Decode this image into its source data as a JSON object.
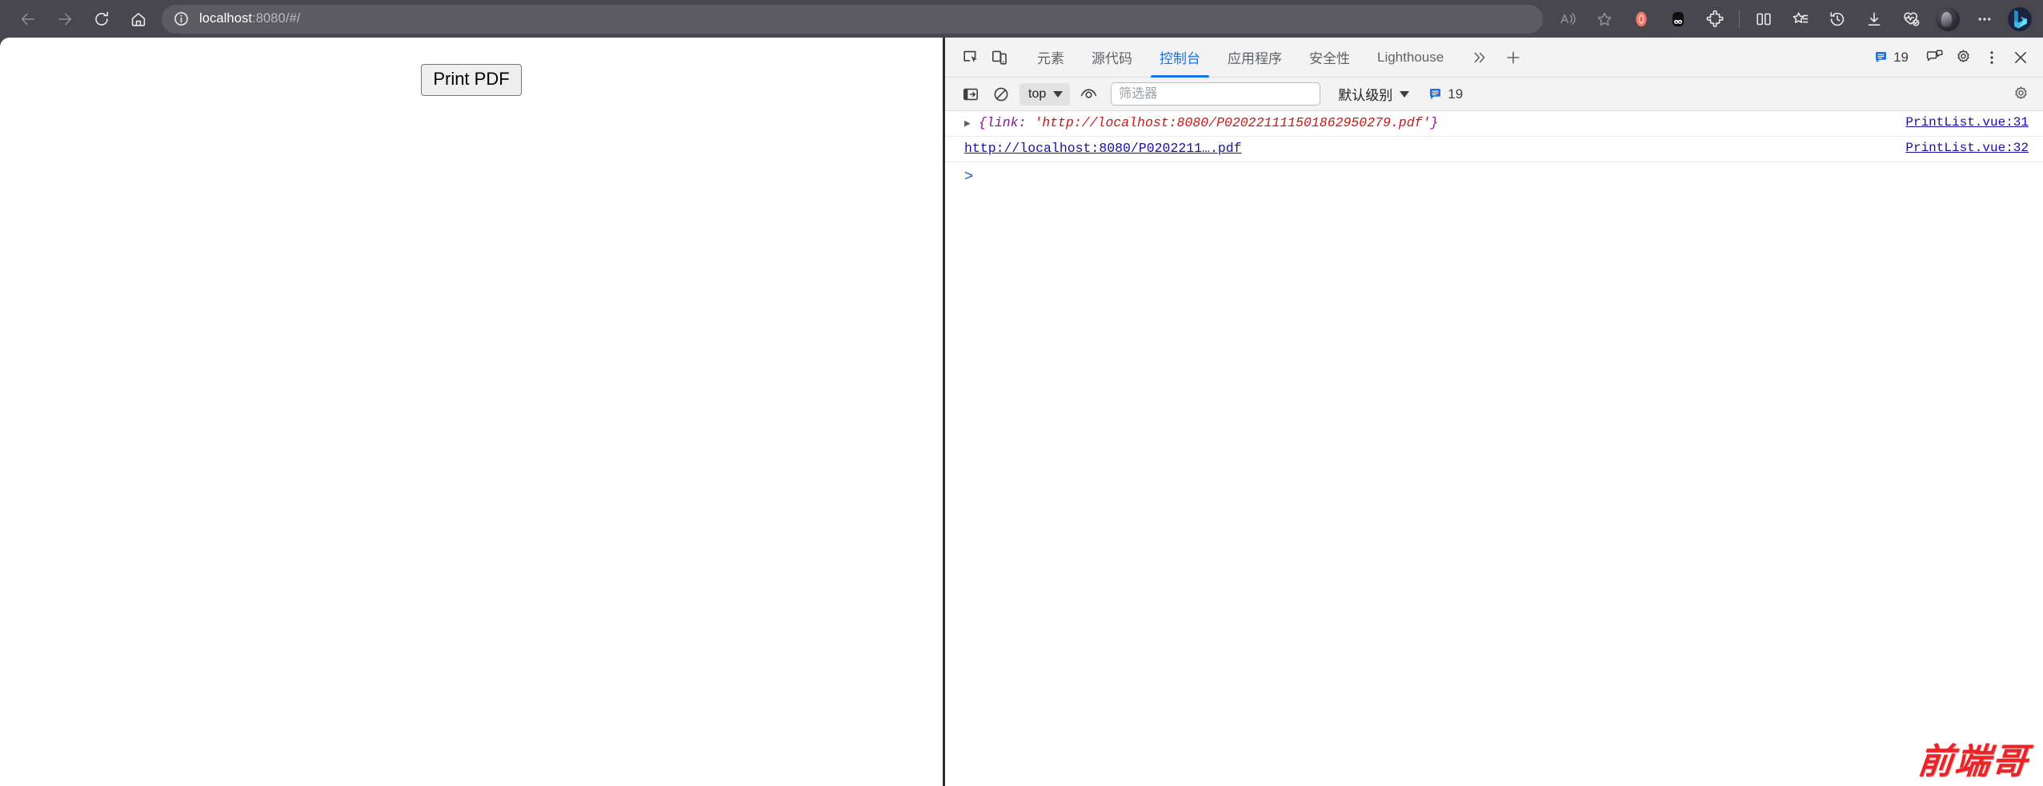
{
  "browser": {
    "nav": {
      "back": "Back",
      "forward": "Forward",
      "refresh": "Refresh",
      "home": "Home"
    },
    "address": {
      "host": "localhost",
      "rest": ":8080/#/",
      "full_url": "localhost:8080/#/",
      "site_info_label": "View site information"
    },
    "toolbar_icons": [
      "read-aloud-icon",
      "favorite-star-icon",
      "opera-circle-icon",
      "panda-extension-icon",
      "extensions-puzzle-icon",
      "split-screen-icon",
      "collections-icon",
      "history-icon",
      "downloads-icon",
      "browser-essentials-icon",
      "profile-avatar",
      "settings-more-icon",
      "copilot-bing-icon"
    ],
    "chrome_bg": "#47474d",
    "address_bg": "#5b5b61"
  },
  "page": {
    "print_button_label": "Print PDF",
    "watermark": "前端哥",
    "watermark_color": "#e8262a"
  },
  "devtools": {
    "accent_color": "#1a73e8",
    "inspect_icon": "inspect-element-icon",
    "device_icon": "device-toolbar-icon",
    "tabs": [
      {
        "label": "元素",
        "active": false
      },
      {
        "label": "源代码",
        "active": false
      },
      {
        "label": "控制台",
        "active": true
      },
      {
        "label": "应用程序",
        "active": false
      },
      {
        "label": "安全性",
        "active": false
      },
      {
        "label": "Lighthouse",
        "active": false
      }
    ],
    "more_tabs_label": "»",
    "add_tab_label": "+",
    "message_count": "19",
    "tabbar_icons": [
      "feedback-icon",
      "settings-gear-icon",
      "more-options-icon",
      "close-icon"
    ],
    "console_toolbar": {
      "sidebar_toggle": "console-sidebar-icon",
      "clear_console": "clear-console-icon",
      "context": "top",
      "eye_icon": "live-expression-eye-icon",
      "filter_placeholder": "筛选器",
      "filter_value": "",
      "level": "默认级别",
      "message_count": "19",
      "settings_icon": "settings-gear-icon"
    },
    "messages": [
      {
        "type": "object",
        "expandable": true,
        "text_prefix": "{",
        "key": "link: ",
        "value": "'http://localhost:8080/P020221111501862950279.pdf'",
        "text_suffix": "}",
        "source": "PrintList.vue:31"
      },
      {
        "type": "link",
        "expandable": false,
        "url_text": "http://localhost:8080/P0202211….pdf",
        "source": "PrintList.vue:32"
      }
    ],
    "prompt": ">"
  }
}
